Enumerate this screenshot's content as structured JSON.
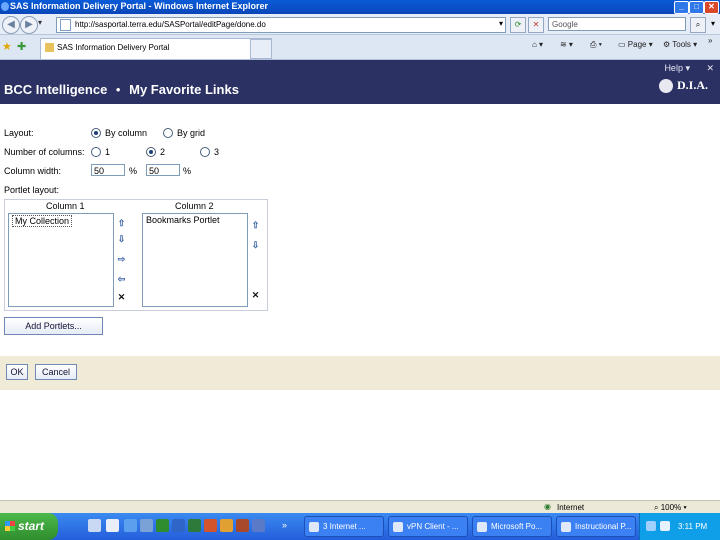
{
  "window": {
    "title": "SAS Information Delivery Portal - Windows Internet Explorer",
    "buttons": [
      "_",
      "□",
      "✕"
    ]
  },
  "browser": {
    "address": "http://sasportal.terra.edu/SASPortal/editPage/done.do",
    "search_placeholder": "Google",
    "tab_label": "SAS Information Delivery Portal",
    "toolbar": {
      "page": "Page",
      "tools": "Tools",
      "more": "»"
    }
  },
  "portal": {
    "help": "Help",
    "help_menu": "▾",
    "app_name": "BCC Intelligence",
    "separator": "•",
    "page_title": "My Favorite Links",
    "logo_text": "D.I.A."
  },
  "form": {
    "layout_label": "Layout:",
    "layout_options": [
      "By column",
      "By grid"
    ],
    "layout_selected": 0,
    "columns_label": "Number of columns:",
    "column_options": [
      "1",
      "2",
      "3"
    ],
    "columns_selected": 1,
    "width_label": "Column width:",
    "width_values": [
      "50",
      "50"
    ],
    "percent_symbol": "%",
    "portlet_layout_label": "Portlet layout:",
    "columns": [
      {
        "header": "Column 1",
        "items": [
          "My Collection"
        ]
      },
      {
        "header": "Column 2",
        "items": [
          "Bookmarks Portlet"
        ]
      }
    ],
    "add_portlets": "Add Portlets...",
    "ok": "OK",
    "cancel": "Cancel"
  },
  "statusbar": {
    "zone": "Internet",
    "zoom": "100%"
  },
  "taskbar": {
    "start": "start",
    "tasks": [
      "3 Internet ...",
      "vPN Client - ...",
      "Microsoft Po...",
      "Instructional P..."
    ],
    "clock": "3:11 PM"
  },
  "icons": {
    "up": "arrow-up-icon",
    "down": "arrow-down-icon",
    "right": "arrow-right-icon",
    "left": "arrow-left-icon",
    "remove": "remove-x-icon"
  },
  "colors": {
    "portal_header": "#2b3162",
    "footer_band": "#efebd6",
    "taskbar": "#245edb",
    "start": "#2f8d2d"
  }
}
